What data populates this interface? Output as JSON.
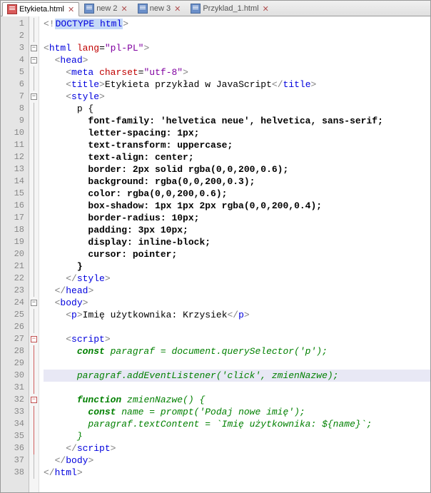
{
  "tabs": [
    {
      "label": "Etykieta.html",
      "active": true
    },
    {
      "label": "new 2",
      "active": false
    },
    {
      "label": "new 3",
      "active": false
    },
    {
      "label": "Przyklad_1.html",
      "active": false
    }
  ],
  "close_glyph": "✕",
  "fold_minus": "−",
  "lines": {
    "1": {
      "t": [
        {
          "c": "gray",
          "w": "<!"
        },
        {
          "c": "hilite blue",
          "w": "DOCTYPE html"
        },
        {
          "c": "gray",
          "w": ">"
        }
      ]
    },
    "2": {
      "t": []
    },
    "3": {
      "t": [
        {
          "c": "gray",
          "w": "<"
        },
        {
          "c": "blue",
          "w": "html"
        },
        {
          "c": "black",
          "w": " "
        },
        {
          "c": "red",
          "w": "lang"
        },
        {
          "c": "black",
          "w": "="
        },
        {
          "c": "purple",
          "w": "\"pl-PL\""
        },
        {
          "c": "gray",
          "w": ">"
        }
      ]
    },
    "4": {
      "i": 1,
      "t": [
        {
          "c": "gray",
          "w": "<"
        },
        {
          "c": "blue",
          "w": "head"
        },
        {
          "c": "gray",
          "w": ">"
        }
      ]
    },
    "5": {
      "i": 2,
      "t": [
        {
          "c": "gray",
          "w": "<"
        },
        {
          "c": "blue",
          "w": "meta"
        },
        {
          "c": "black",
          "w": " "
        },
        {
          "c": "red",
          "w": "charset"
        },
        {
          "c": "black",
          "w": "="
        },
        {
          "c": "purple",
          "w": "\"utf-8\""
        },
        {
          "c": "gray",
          "w": ">"
        }
      ]
    },
    "6": {
      "i": 2,
      "t": [
        {
          "c": "gray",
          "w": "<"
        },
        {
          "c": "blue",
          "w": "title"
        },
        {
          "c": "gray",
          "w": ">"
        },
        {
          "c": "black",
          "w": "Etykieta przykład w JavaScript"
        },
        {
          "c": "gray",
          "w": "</"
        },
        {
          "c": "blue",
          "w": "title"
        },
        {
          "c": "gray",
          "w": ">"
        }
      ]
    },
    "7": {
      "i": 2,
      "t": [
        {
          "c": "gray",
          "w": "<"
        },
        {
          "c": "blue",
          "w": "style"
        },
        {
          "c": "gray",
          "w": ">"
        }
      ]
    },
    "8": {
      "i": 3,
      "t": [
        {
          "c": "black",
          "w": "p {"
        }
      ]
    },
    "9": {
      "i": 4,
      "t": [
        {
          "c": "black bold",
          "w": "font-family: 'helvetica neue', helvetica, sans-serif;"
        }
      ]
    },
    "10": {
      "i": 4,
      "t": [
        {
          "c": "black bold",
          "w": "letter-spacing: 1px;"
        }
      ]
    },
    "11": {
      "i": 4,
      "t": [
        {
          "c": "black bold",
          "w": "text-transform: uppercase;"
        }
      ]
    },
    "12": {
      "i": 4,
      "t": [
        {
          "c": "black bold",
          "w": "text-align: center;"
        }
      ]
    },
    "13": {
      "i": 4,
      "t": [
        {
          "c": "black bold",
          "w": "border: 2px solid rgba(0,0,200,0.6);"
        }
      ]
    },
    "14": {
      "i": 4,
      "t": [
        {
          "c": "black bold",
          "w": "background: rgba(0,0,200,0.3);"
        }
      ]
    },
    "15": {
      "i": 4,
      "t": [
        {
          "c": "black bold",
          "w": "color: rgba(0,0,200,0.6);"
        }
      ]
    },
    "16": {
      "i": 4,
      "t": [
        {
          "c": "black bold",
          "w": "box-shadow: 1px 1px 2px rgba(0,0,200,0.4);"
        }
      ]
    },
    "17": {
      "i": 4,
      "t": [
        {
          "c": "black bold",
          "w": "border-radius: 10px;"
        }
      ]
    },
    "18": {
      "i": 4,
      "t": [
        {
          "c": "black bold",
          "w": "padding: 3px 10px;"
        }
      ]
    },
    "19": {
      "i": 4,
      "t": [
        {
          "c": "black bold",
          "w": "display: inline-block;"
        }
      ]
    },
    "20": {
      "i": 4,
      "t": [
        {
          "c": "black bold",
          "w": "cursor: pointer;"
        }
      ]
    },
    "21": {
      "i": 3,
      "t": [
        {
          "c": "black bold",
          "w": "}"
        }
      ]
    },
    "22": {
      "i": 2,
      "t": [
        {
          "c": "gray",
          "w": "</"
        },
        {
          "c": "blue",
          "w": "style"
        },
        {
          "c": "gray",
          "w": ">"
        }
      ]
    },
    "23": {
      "i": 1,
      "t": [
        {
          "c": "gray",
          "w": "</"
        },
        {
          "c": "blue",
          "w": "head"
        },
        {
          "c": "gray",
          "w": ">"
        }
      ]
    },
    "24": {
      "i": 1,
      "t": [
        {
          "c": "gray",
          "w": "<"
        },
        {
          "c": "blue",
          "w": "body"
        },
        {
          "c": "gray",
          "w": ">"
        }
      ]
    },
    "25": {
      "i": 2,
      "t": [
        {
          "c": "gray",
          "w": "<"
        },
        {
          "c": "blue",
          "w": "p"
        },
        {
          "c": "gray",
          "w": ">"
        },
        {
          "c": "black",
          "w": "Imię użytkownika: Krzysiek"
        },
        {
          "c": "gray",
          "w": "</"
        },
        {
          "c": "blue",
          "w": "p"
        },
        {
          "c": "gray",
          "w": ">"
        }
      ]
    },
    "26": {
      "t": []
    },
    "27": {
      "i": 2,
      "t": [
        {
          "c": "gray",
          "w": "<"
        },
        {
          "c": "blue",
          "w": "script"
        },
        {
          "c": "gray",
          "w": ">"
        }
      ]
    },
    "28": {
      "i": 3,
      "t": [
        {
          "c": "green bold",
          "w": "const"
        },
        {
          "c": "green",
          "w": " paragraf = document.querySelector('p');"
        }
      ]
    },
    "29": {
      "t": []
    },
    "30": {
      "i": 3,
      "hl": true,
      "t": [
        {
          "c": "green",
          "w": "paragraf.addEventListener('click', zmienNazwe);"
        }
      ]
    },
    "31": {
      "t": []
    },
    "32": {
      "i": 3,
      "t": [
        {
          "c": "green bold",
          "w": "function"
        },
        {
          "c": "green",
          "w": " zmienNazwe() {"
        }
      ]
    },
    "33": {
      "i": 4,
      "t": [
        {
          "c": "green bold",
          "w": "const"
        },
        {
          "c": "green",
          "w": " name = prompt('Podaj nowe imię');"
        }
      ]
    },
    "34": {
      "i": 4,
      "t": [
        {
          "c": "green",
          "w": "paragraf.textContent = `Imię użytkownika: ${name}`;"
        }
      ]
    },
    "35": {
      "i": 3,
      "t": [
        {
          "c": "green",
          "w": "}"
        }
      ]
    },
    "36": {
      "i": 2,
      "t": [
        {
          "c": "gray",
          "w": "</"
        },
        {
          "c": "blue",
          "w": "script"
        },
        {
          "c": "gray",
          "w": ">"
        }
      ]
    },
    "37": {
      "i": 1,
      "t": [
        {
          "c": "gray",
          "w": "</"
        },
        {
          "c": "blue",
          "w": "body"
        },
        {
          "c": "gray",
          "w": ">"
        }
      ]
    },
    "38": {
      "t": [
        {
          "c": "gray",
          "w": "</"
        },
        {
          "c": "blue",
          "w": "html"
        },
        {
          "c": "gray",
          "w": ">"
        }
      ]
    }
  },
  "fold_marks": {
    "3": "n",
    "4": "n",
    "7": "n",
    "24": "n",
    "27": "r",
    "32": "r"
  },
  "fold_bar_segments": {
    "27": {
      "color": "#d06060"
    },
    "28": {
      "color": "#d06060"
    },
    "29": {
      "color": "#d06060"
    },
    "30": {
      "color": "#d06060"
    },
    "31": {
      "color": "#d06060"
    },
    "33": {
      "color": "#d06060"
    },
    "34": {
      "color": "#d06060"
    },
    "35": {
      "color": "#d06060"
    },
    "36": {
      "color": "#d06060"
    }
  }
}
